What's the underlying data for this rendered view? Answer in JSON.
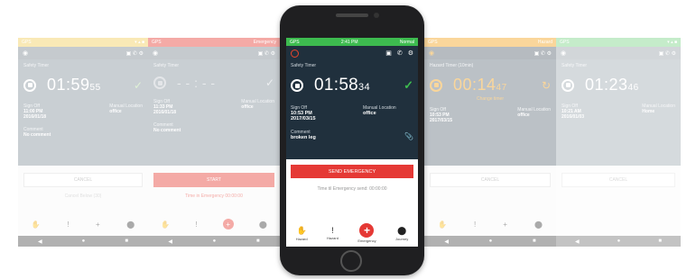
{
  "colors": {
    "green": "#3dbb4f",
    "navy": "#20303d",
    "red": "#e53935",
    "orange": "#f5a623",
    "grey": "#9aa5ad"
  },
  "main": {
    "status_left": "GPS",
    "status_right": "Normal",
    "status_mid": "2:41 PM",
    "panel_title": "Safety Timer",
    "timer_main": "01:58",
    "timer_sec": "34",
    "signoff_label": "Sign Off",
    "signoff_time": "10:53 PM",
    "signoff_date": "2017/03/15",
    "location_label": "Manual Location",
    "location_value": "office",
    "comment_label": "Comment",
    "comment_value": "broken leg",
    "emergency_button": "SEND EMERGENCY",
    "emergency_hint": "Time til Emergency send: 00:00:00",
    "tabs": [
      "Hazard",
      "Hazard",
      "Emergency",
      "Journey"
    ]
  },
  "left1": {
    "panel_title": "Safety Timer",
    "timer_main": "01:59",
    "timer_sec": "55",
    "signoff_label": "Sign Off",
    "signoff_time": "11:00 PM",
    "signoff_date": "2016/01/18",
    "location_label": "Manual Location",
    "location_value": "office",
    "comment_label": "Comment",
    "comment_value": "No comment",
    "button": "CANCEL",
    "hint": "Cancel Below (30)"
  },
  "left2": {
    "status_right": "Emergency",
    "panel_title": "Safety Timer",
    "timer_main": "- - : - -",
    "signoff_label": "Sign Off",
    "signoff_time": "11:33 PM",
    "signoff_date": "2016/01/18",
    "location_label": "Manual Location",
    "location_value": "office",
    "comment_label": "Comment",
    "comment_value": "No comment",
    "button": "START",
    "hint": "Time in Emergency 00:00:00"
  },
  "right1": {
    "status_right": "Hazard",
    "panel_title": "Hazard Timer (10min)",
    "timer_main": "00:14",
    "timer_sec": "47",
    "change": "Change timer",
    "signoff_label": "Sign Off",
    "signoff_time": "10:53 PM",
    "signoff_date": "2017/03/15",
    "location_label": "Manual Location",
    "location_value": "office",
    "button": "CANCEL"
  },
  "right2": {
    "panel_title": "Safety Timer",
    "timer_main": "01:23",
    "timer_sec": "46",
    "signoff_label": "Sign Off",
    "signoff_time": "10:21 AM",
    "signoff_date": "2016/01/03",
    "location_label": "Manual Location",
    "location_value": "Home",
    "button": "CANCEL"
  }
}
